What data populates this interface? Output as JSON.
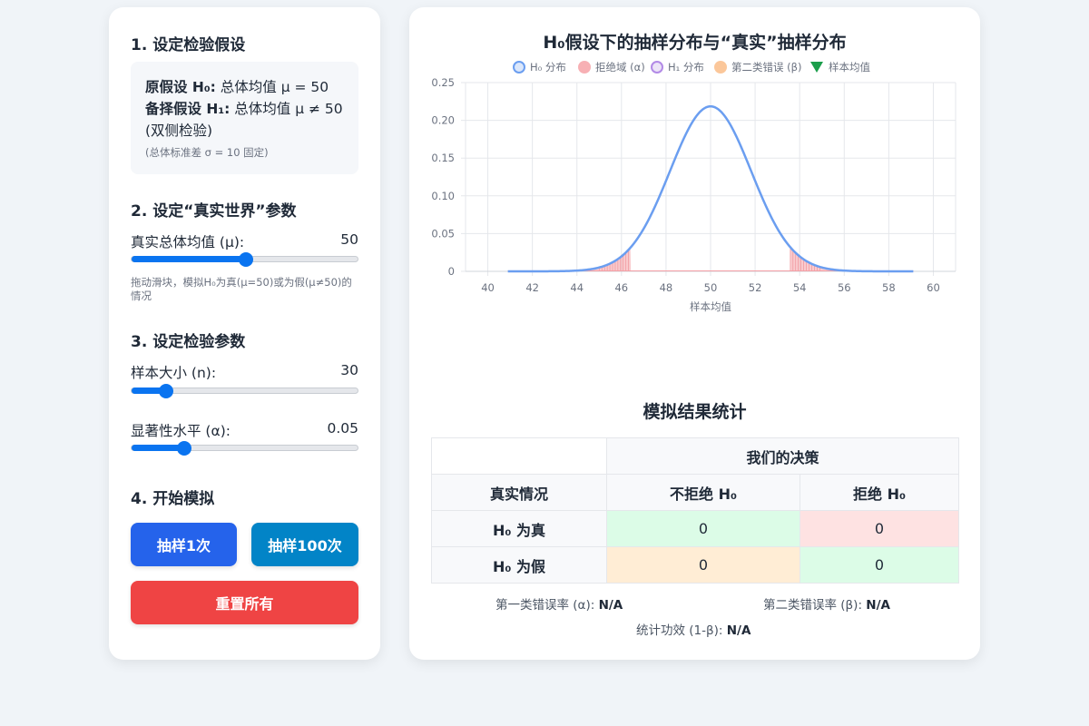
{
  "controls": {
    "s1_title": "1. 设定检验假设",
    "h0_label": "原假设 H₀:",
    "h0_text": "总体均值 μ = 50",
    "h1_label": "备择假设 H₁:",
    "h1_text": "总体均值 μ ≠ 50",
    "h1_type": "(双侧检验)",
    "sigma_note": "(总体标准差 σ = 10 固定)",
    "s2_title": "2. 设定“真实世界”参数",
    "true_mean_label": "真实总体均值 (μ):",
    "true_mean_value": "50",
    "true_mean_fraction": 0.5,
    "true_mean_hint": "拖动滑块，模拟H₀为真(μ=50)或为假(μ≠50)的情况",
    "s3_title": "3. 设定检验参数",
    "n_label": "样本大小 (n):",
    "n_value": "30",
    "n_fraction": 0.15,
    "alpha_label": "显著性水平 (α):",
    "alpha_value": "0.05",
    "alpha_fraction": 0.23,
    "s4_title": "4. 开始模拟",
    "btn_sample_1": "抽样1次",
    "btn_sample_100": "抽样100次",
    "btn_reset": "重置所有"
  },
  "colors": {
    "btn_sample_1": "#2563eb",
    "btn_sample_100": "#0284c7",
    "btn_reset": "#ef4444",
    "slider": "#0a74f0",
    "h0_curve": "#6b9ef0",
    "rejection": "#f4a0a6"
  },
  "chart_data": {
    "type": "line",
    "title": "H₀假设下的抽样分布与“真实”抽样分布",
    "xlabel": "样本均值",
    "ylabel": "",
    "xlim": [
      39,
      61
    ],
    "ylim": [
      0,
      0.25
    ],
    "x_ticks": [
      "40",
      "42",
      "44",
      "46",
      "48",
      "50",
      "52",
      "54",
      "56",
      "58",
      "60"
    ],
    "y_ticks": [
      "0",
      "0.05",
      "0.10",
      "0.15",
      "0.20",
      "0.25"
    ],
    "h0_distribution": {
      "mean": 50,
      "sd": 1.826,
      "x_range": [
        40.9,
        59.1
      ]
    },
    "rejection_region": {
      "lower": 46.42,
      "upper": 53.58
    },
    "grid": true,
    "legend_position": "top",
    "legend": [
      "H₀ 分布",
      "拒绝域 (α)",
      "H₁ 分布",
      "第二类错误 (β)",
      "样本均值"
    ]
  },
  "stats": {
    "title": "模拟结果统计",
    "decision_header": "我们的决策",
    "truth_header": "真实情况",
    "col_not_reject": "不拒绝 H₀",
    "col_reject": "拒绝 H₀",
    "row_h0_true": "H₀ 为真",
    "row_h0_false": "H₀ 为假",
    "h0_true_not_reject": "0",
    "h0_true_reject": "0",
    "h0_false_not_reject": "0",
    "h0_false_reject": "0",
    "type1_label": "第一类错误率 (α):",
    "type1_value": "N/A",
    "type2_label": "第二类错误率 (β):",
    "type2_value": "N/A",
    "power_label": "统计功效 (1-β):",
    "power_value": "N/A"
  }
}
